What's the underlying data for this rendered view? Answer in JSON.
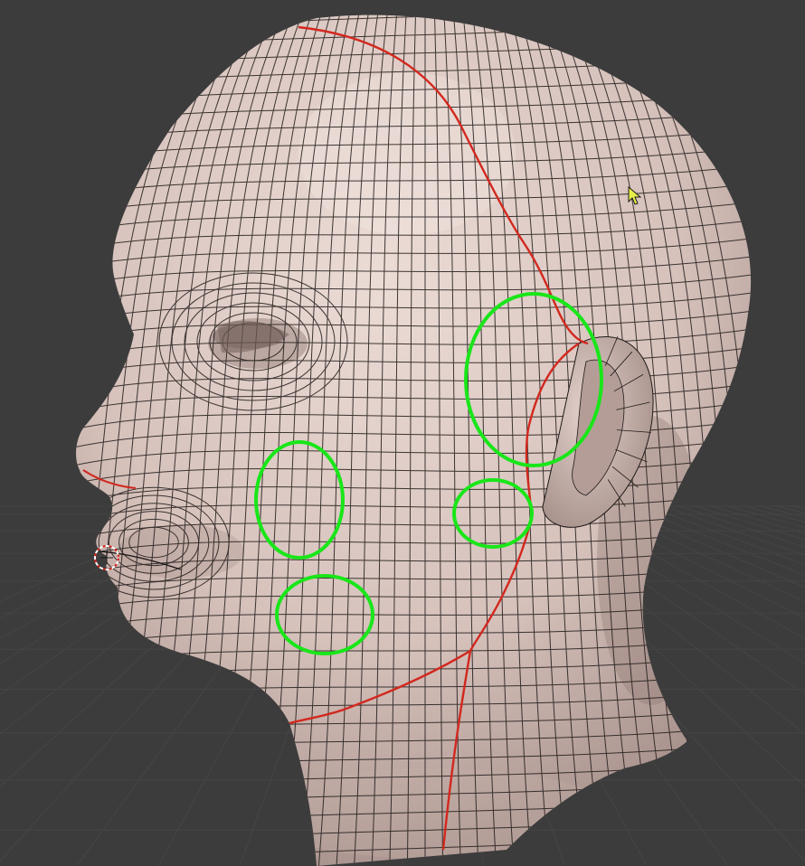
{
  "viewport": {
    "background": "#3c3c3c",
    "grid_color": "#454545"
  },
  "mesh": {
    "skin_color": "#d6c1bb",
    "wire_color": "#1f1a19",
    "seam_color": "#d2281e"
  },
  "annotations": {
    "highlight_color": "#19e619",
    "regions": [
      "ear-pole",
      "jaw-pole",
      "cheek-pole",
      "chin-pole"
    ]
  },
  "icons": {
    "cursor": "arrow-cursor-icon",
    "origin": "object-origin-icon"
  }
}
